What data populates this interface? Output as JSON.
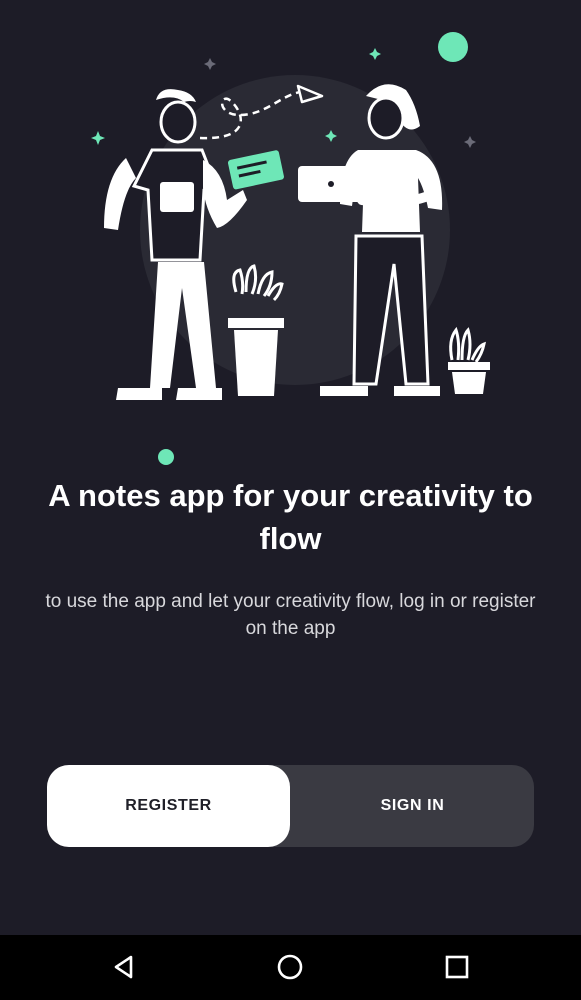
{
  "welcome": {
    "headline": "A notes app for your creativity to flow",
    "subtitle": "to use the app and let your creativity flow, log in or register on the app"
  },
  "auth_toggle": {
    "register_label": "REGISTER",
    "signin_label": "SIGN IN",
    "selected": "REGISTER"
  },
  "colors": {
    "background": "#1d1c27",
    "accent": "#6ee7b7",
    "toggle_track": "#3a3a42",
    "toggle_selected": "#ffffff"
  },
  "nav_bar": {
    "back_icon": "back-triangle-icon",
    "home_icon": "home-circle-icon",
    "recents_icon": "recents-square-icon"
  }
}
